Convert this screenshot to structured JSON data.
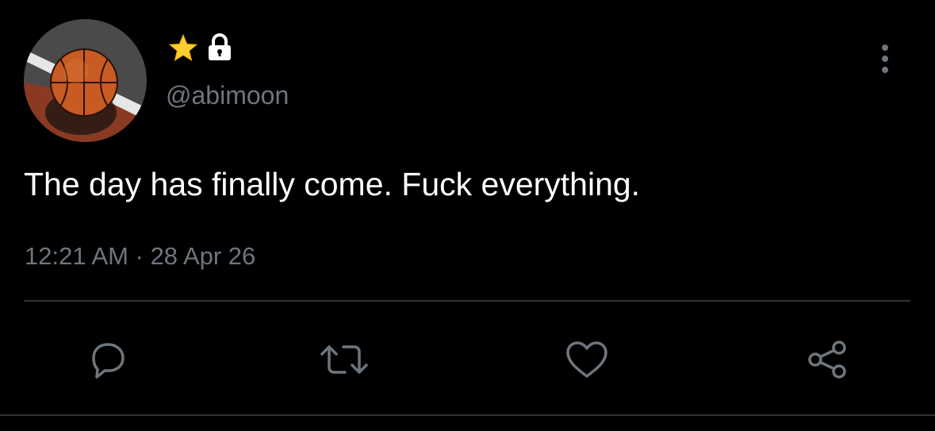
{
  "user": {
    "handle": "@abimoon",
    "badges": [
      "star-icon",
      "lock-icon"
    ],
    "avatar": "basketball-photo"
  },
  "tweet": {
    "text": "The day has finally come. Fuck everything.",
    "time": "12:21 AM",
    "separator": "·",
    "date": "28 Apr 26"
  },
  "actions": [
    "reply-icon",
    "retweet-icon",
    "like-icon",
    "share-icon"
  ],
  "colors": {
    "background": "#000000",
    "text": "#ffffff",
    "secondary": "#6e767d",
    "divider": "#2f3336",
    "star": "#ffcc33"
  }
}
